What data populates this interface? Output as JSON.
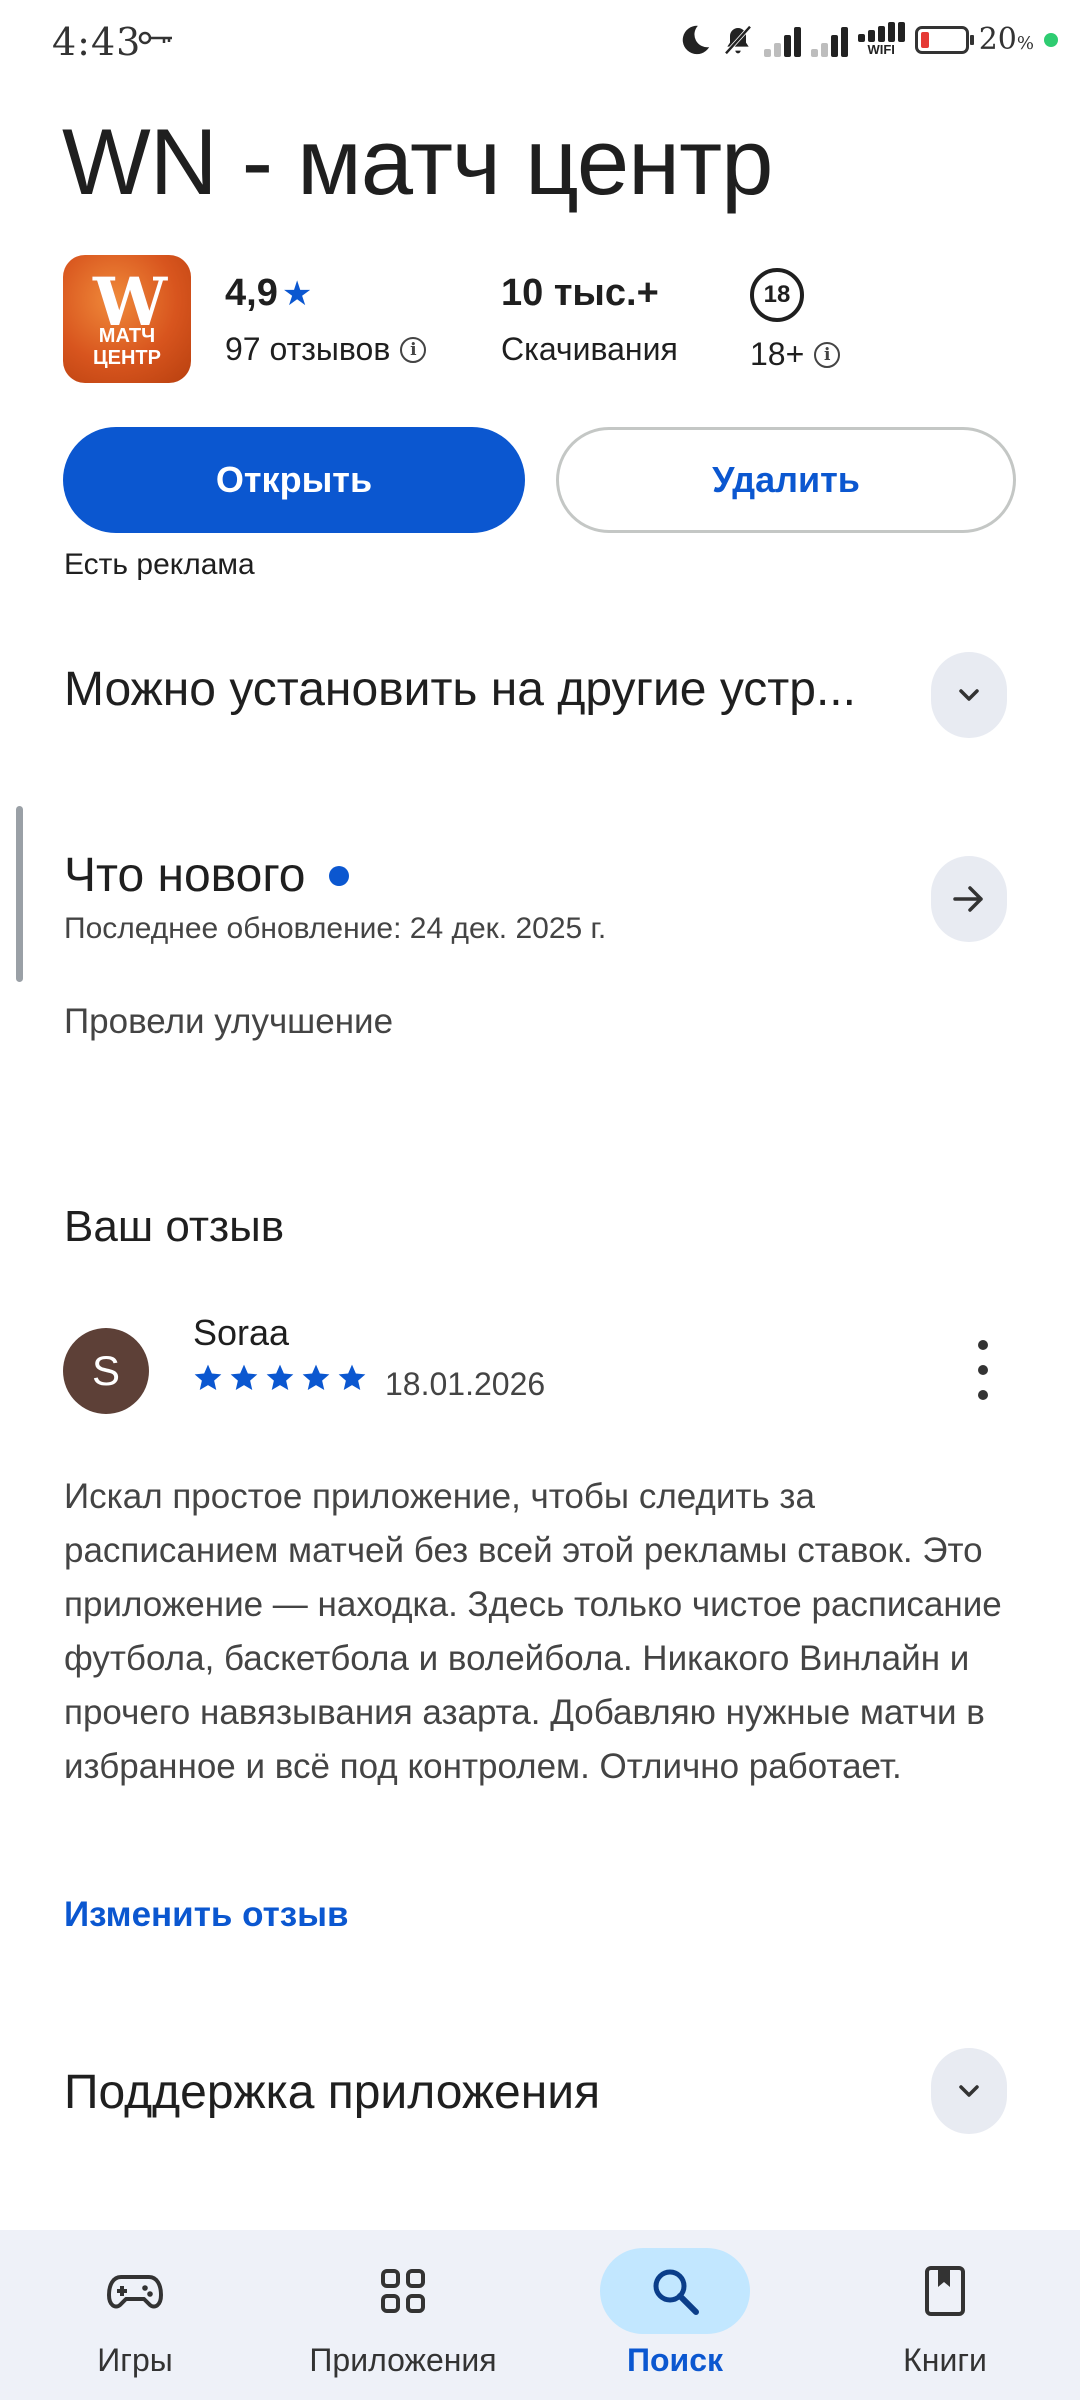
{
  "status_bar": {
    "time": "4:43",
    "battery_percent": "20",
    "battery_symbol": "%",
    "wifi_label": "WIFI",
    "battery_level": 0.2
  },
  "app": {
    "title": "WN - матч центр",
    "icon_letter": "W",
    "icon_text_line1": "МАТЧ",
    "icon_text_line2": "ЦЕНТР",
    "rating": "4,9",
    "rating_star": "★",
    "reviews_count": "97 отзывов",
    "downloads": "10 тыс.+",
    "downloads_label": "Скачивания",
    "age_badge": "18",
    "age_label": "18+"
  },
  "actions": {
    "open_label": "Открыть",
    "uninstall_label": "Удалить",
    "ads_note": "Есть реклама"
  },
  "sections": {
    "other_devices": "Можно установить на другие устр...",
    "whats_new_title": "Что нового",
    "whats_new_date": "Последнее обновление: 24 дек. 2025 г.",
    "whats_new_text": "Провели улучшение",
    "your_review_title": "Ваш отзыв",
    "app_support": "Поддержка приложения"
  },
  "review": {
    "avatar_letter": "S",
    "author": "Soraa",
    "stars": 5,
    "date": "18.01.2026",
    "text": "Искал простое приложение, чтобы следить за расписанием матчей без всей этой рекламы ставок. Это приложение — находка. Здесь только чистое расписание футбола, баскетбола и волейбола. Никакого Винлайн и прочего навязывания азарта. Добавляю нужные матчи в избранное и всё под контролем. Отлично работает.",
    "edit_label": "Изменить отзыв"
  },
  "bottom_nav": {
    "games": "Игры",
    "apps": "Приложения",
    "search": "Поиск",
    "books": "Книги",
    "active": "search"
  },
  "colors": {
    "accent": "#0b57d0",
    "nav_bg": "#eef1f8",
    "nav_active": "#c2e7ff",
    "chip_bg": "#e8ebf2"
  }
}
